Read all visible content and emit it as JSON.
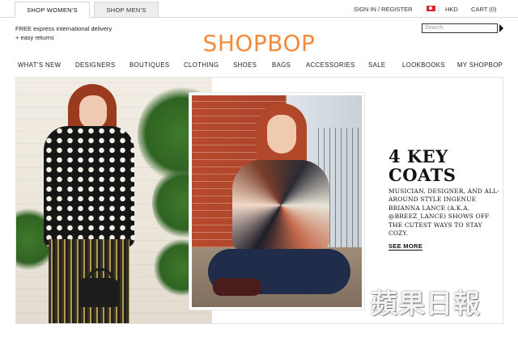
{
  "tabs": {
    "women": "SHOP WOMEN'S",
    "men": "SHOP MEN'S"
  },
  "utility": {
    "signin": "SIGN IN / REGISTER",
    "separator": "|",
    "currency": "HKD",
    "cart": "CART (0)",
    "flag_icon": "hong-kong-flag-icon"
  },
  "promo": {
    "line1_strong": "FREE",
    "line1_rest": " express international delivery",
    "line2": "+ easy returns"
  },
  "logo": {
    "text": "SHOPBOP",
    "color": "#f38b3c"
  },
  "search": {
    "placeholder": "Search"
  },
  "nav": {
    "items": [
      "WHAT'S NEW",
      "DESIGNERS",
      "BOUTIQUES",
      "CLOTHING",
      "SHOES",
      "BAGS",
      "ACCESSORIES",
      "SALE",
      "LOOKBOOKS",
      "MY SHOPBOP"
    ]
  },
  "hero": {
    "headline_line1": "4 KEY",
    "headline_line2": "COATS",
    "body": "MUSICIAN, DESIGNER, AND ALL-AROUND STYLE INGENUE BRIANNA LANCE (A.K.A. @BREEZ_LANCE) SHOWS OFF THE CUTEST WAYS TO STAY COZY.",
    "cta": "SEE MORE"
  },
  "watermark": {
    "text": "蘋果日報"
  }
}
